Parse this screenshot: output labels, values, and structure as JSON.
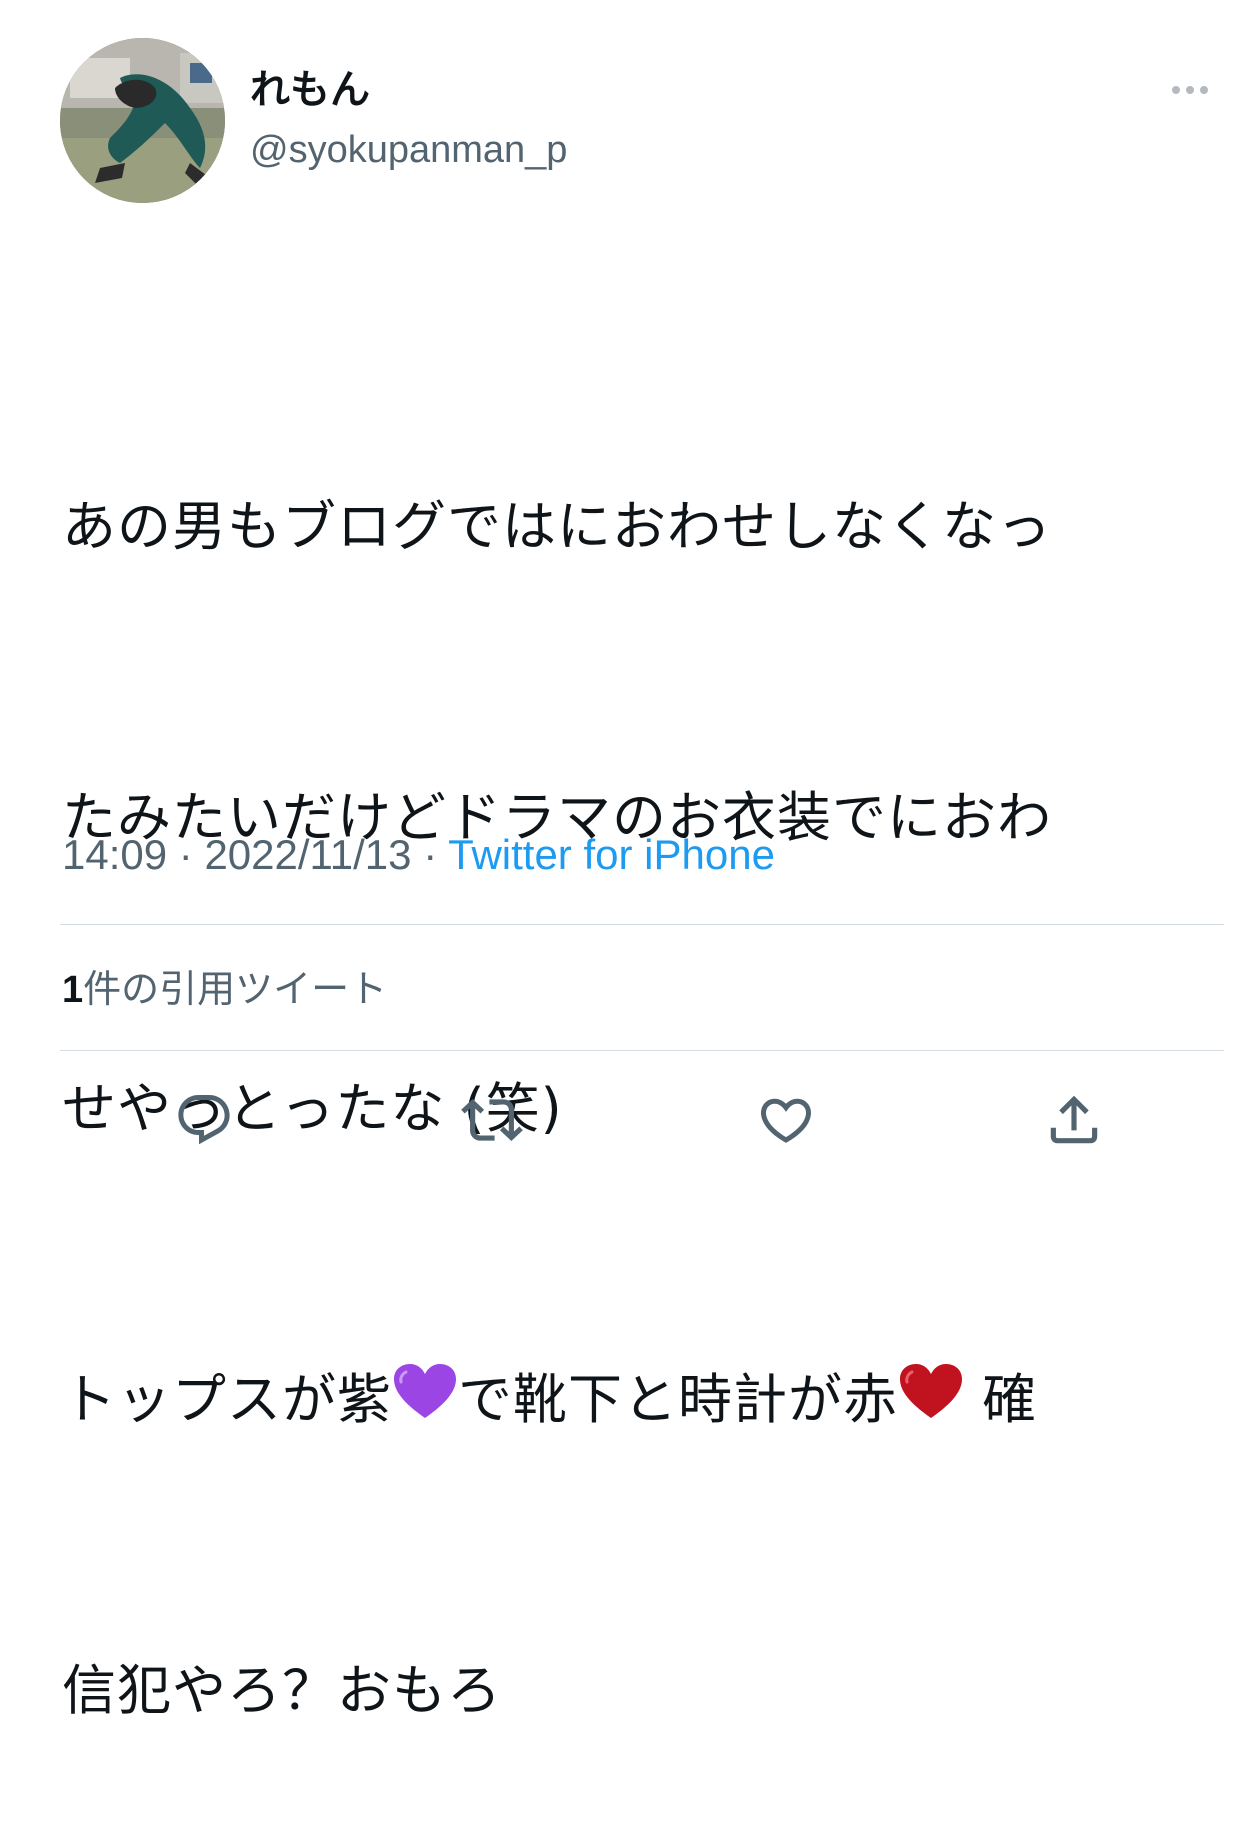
{
  "user": {
    "display_name": "れもん",
    "handle": "@syokupanman_p"
  },
  "tweet": {
    "lines": [
      "あの男もブログではにおわせしなくなっ",
      "たみたいだけどドラマのお衣装でにおわ",
      "せやっとったな (笑)"
    ],
    "line4_part1": "トップスが紫",
    "line4_part2": "で靴下と時計が赤",
    "line4_part3": " 確",
    "line5": "信犯やろ？おもろ"
  },
  "meta": {
    "time": "14:09",
    "sep1": " · ",
    "date": "2022/11/13",
    "sep2": " · ",
    "source": "Twitter for iPhone"
  },
  "quotes": {
    "count": "1",
    "label": "件の引用ツイート"
  },
  "icons": {
    "more": "more-horizontal-icon",
    "reply": "reply-icon",
    "retweet": "retweet-icon",
    "like": "heart-outline-icon",
    "share": "share-icon",
    "purple_heart": "purple-heart-emoji",
    "red_heart": "red-heart-emoji"
  },
  "colors": {
    "text": "#0f1419",
    "secondary": "#536471",
    "link": "#1d9bf0",
    "icon": "#536471",
    "divider": "#d6dde2",
    "purple_heart": "#9b45e4",
    "red_heart": "#c1121f"
  }
}
